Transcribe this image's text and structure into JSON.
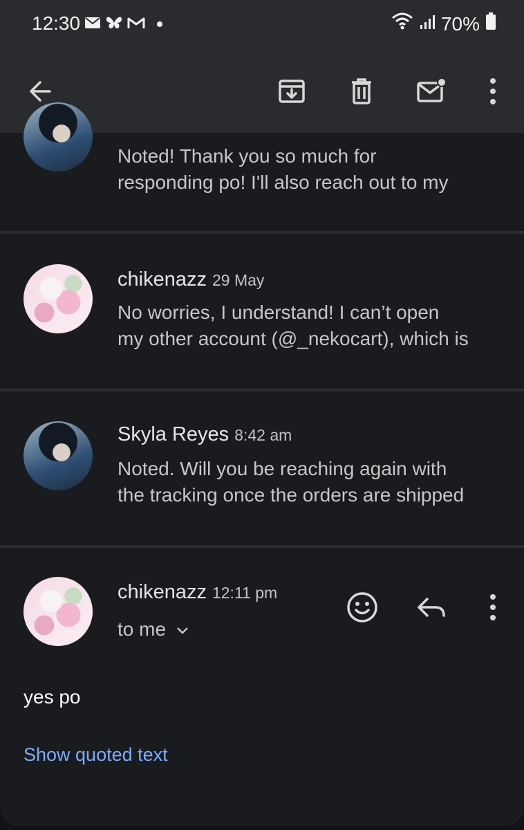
{
  "status_bar": {
    "time": "12:30",
    "battery": "70%",
    "notification_icons": [
      "mail-icon",
      "butterfly-icon",
      "gmail-icon",
      "dot-icon"
    ],
    "system_icons": [
      "wifi-icon",
      "signal-icon",
      "battery-icon"
    ]
  },
  "app_bar": {
    "icons": [
      "back-arrow-icon",
      "archive-icon",
      "delete-icon",
      "mark-unread-icon",
      "more-vert-icon"
    ]
  },
  "thread": [
    {
      "sender": "",
      "date": "",
      "snippet_line1": "Noted! Thank you so much for",
      "snippet_line2": "responding po! I'll also reach out to my"
    },
    {
      "sender": "chikenazz",
      "date": "29 May",
      "snippet_line1": "No worries, I understand! I can’t open",
      "snippet_line2": "my other account (@_nekocart), which is"
    },
    {
      "sender": "Skyla Reyes",
      "date": "8:42 am",
      "snippet_line1": "Noted. Will you be reaching again with",
      "snippet_line2": "the tracking once the orders are shipped"
    }
  ],
  "open_message": {
    "sender": "chikenazz",
    "time": "12:11 pm",
    "recipient": "to me",
    "body": "yes po",
    "show_quoted": "Show quoted text"
  },
  "colors": {
    "background": "#121316",
    "card": "#1a1b1f",
    "bar": "#2a2b2e",
    "link": "#7cacf8"
  }
}
